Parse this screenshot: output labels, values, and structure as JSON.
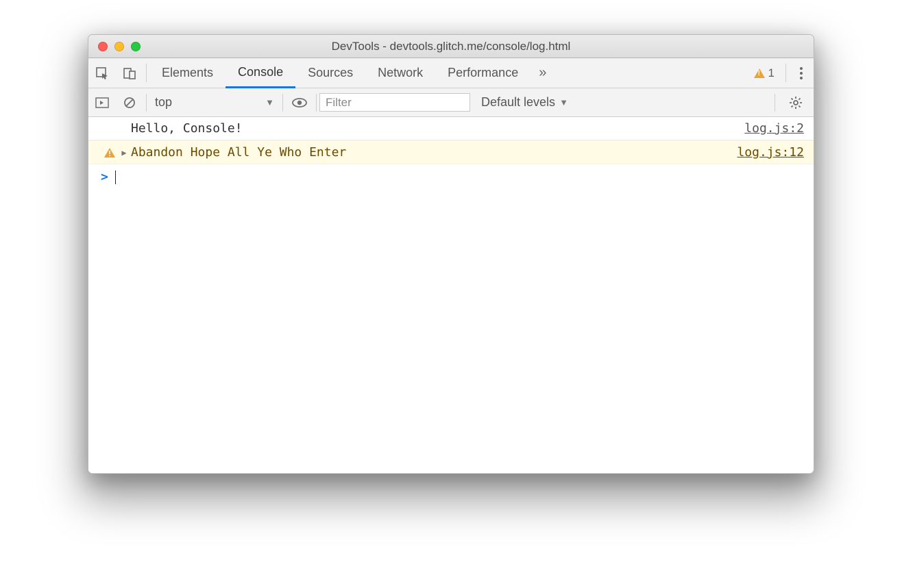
{
  "window": {
    "title": "DevTools - devtools.glitch.me/console/log.html"
  },
  "tabs": {
    "items": [
      "Elements",
      "Console",
      "Sources",
      "Network",
      "Performance"
    ],
    "active_index": 1,
    "warning_count": "1"
  },
  "console_toolbar": {
    "context": "top",
    "filter_placeholder": "Filter",
    "levels_label": "Default levels"
  },
  "console": {
    "entries": [
      {
        "type": "log",
        "message": "Hello, Console!",
        "source": "log.js:2"
      },
      {
        "type": "warn",
        "message": "Abandon Hope All Ye Who Enter",
        "source": "log.js:12"
      }
    ],
    "prompt": ">"
  }
}
